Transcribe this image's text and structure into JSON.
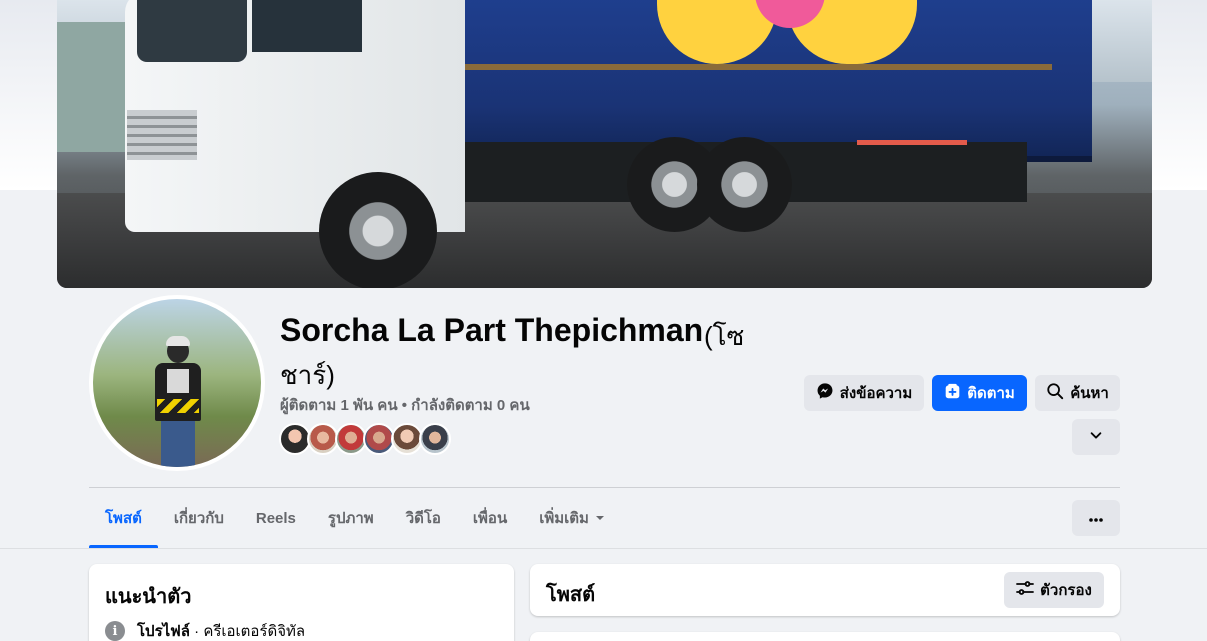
{
  "profile": {
    "name": "Sorcha La Part Thepichman",
    "alt_name_part1": "(โซ",
    "alt_name_part2": "ชาร์)",
    "stats": "ผู้ติดตาม 1 พัน คน • กำลังติดตาม 0 คน"
  },
  "actions": {
    "message_label": "ส่งข้อความ",
    "follow_label": "ติดตาม",
    "search_label": "ค้นหา"
  },
  "tabs": [
    {
      "label": "โพสต์",
      "active": true
    },
    {
      "label": "เกี่ยวกับ"
    },
    {
      "label": "Reels"
    },
    {
      "label": "รูปภาพ"
    },
    {
      "label": "วิดีโอ"
    },
    {
      "label": "เพื่อน"
    },
    {
      "label": "เพิ่มเติม"
    }
  ],
  "intro": {
    "title": "แนะนำตัว",
    "category_label": "โปรไฟล์",
    "category_value": " · ครีเอเตอร์ดิจิทัล"
  },
  "posts": {
    "title": "โพสต์",
    "filter_label": "ตัวกรอง"
  },
  "colors": {
    "accent": "#0866ff",
    "secondary_button": "#e4e6eb",
    "muted_text": "#65676b"
  },
  "icons": {
    "messenger": "messenger-icon",
    "follow": "follow-icon",
    "search": "search-icon",
    "chevron": "chevron-down-icon",
    "ellipsis": "ellipsis-icon",
    "info": "info-icon",
    "filter": "filter-icon"
  }
}
